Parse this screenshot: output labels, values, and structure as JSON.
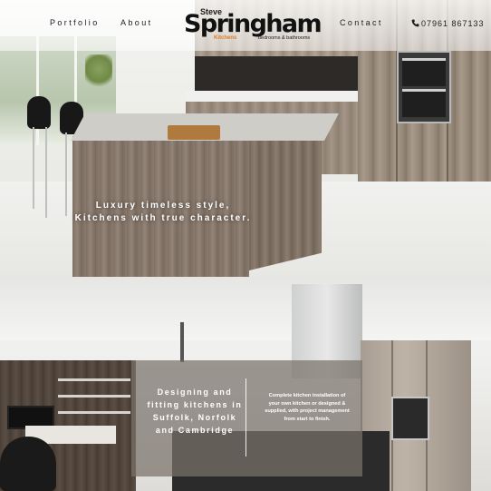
{
  "header": {
    "nav_left": [
      "Portfolio",
      "About"
    ],
    "nav_right": [
      "Contact"
    ],
    "logo": {
      "first_name": "Steve",
      "brand": "Springham",
      "kitchens": "Kitchens",
      "tagline": "bedrooms & bathrooms"
    },
    "phone": {
      "icon": "phone-icon",
      "number": "07961 867133"
    }
  },
  "hero": {
    "tagline_line1": "Luxury timeless style,",
    "tagline_line2": "Kitchens with true character."
  },
  "services": {
    "heading": "Designing and fitting kitchens in Suffolk, Norfolk and Cambridge",
    "description": "Complete kitchen installation of your own kitchen or designed & supplied, with project management from start to finish."
  },
  "colors": {
    "accent": "#e07b24",
    "text_dark": "#111111",
    "panel_overlay": "#78716a"
  }
}
